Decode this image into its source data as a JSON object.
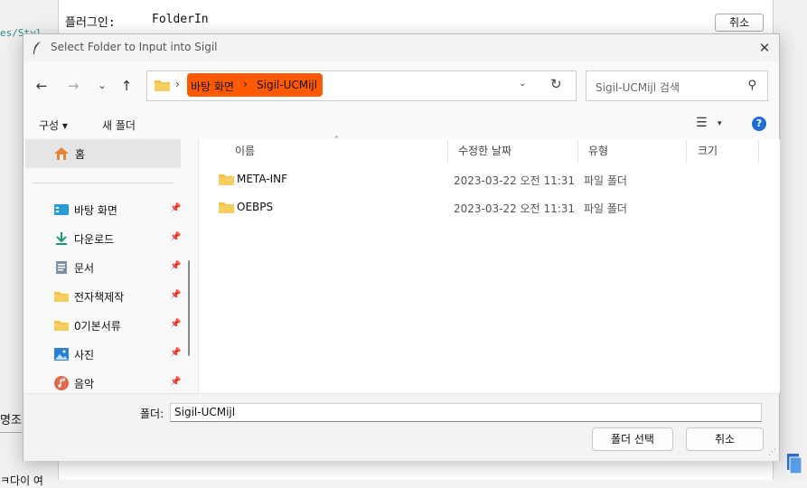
{
  "background": {
    "plugin_label": "플러그인:",
    "plugin_value": "FolderIn",
    "cancel_label": "취소",
    "code_snippet": "es/Styl",
    "left_text": "명조",
    "bottom_left_text": "ㅋ다이 여"
  },
  "dialog": {
    "title": "Select Folder to Input into Sigil",
    "close_glyph": "✕"
  },
  "navigation": {
    "back_glyph": "←",
    "forward_glyph": "→",
    "recent_glyph": "⌄",
    "up_glyph": "↑",
    "breadcrumb_sep": "›",
    "breadcrumbs": [
      "바탕 화면",
      "Sigil-UCMijl"
    ],
    "address_dropdown_glyph": "⌄",
    "refresh_glyph": "↻",
    "search_placeholder": "Sigil-UCMijl 검색",
    "search_glyph": "⚲"
  },
  "command_bar": {
    "organize": "구성 ▾",
    "new_folder": "새 폴더",
    "view_glyph": "☰",
    "view_dropdown_glyph": "▾",
    "help_glyph": "?"
  },
  "sidebar": {
    "home_label": "홈",
    "pin_glyph": "📌",
    "items": [
      {
        "label": "바탕 화면",
        "icon": "desktop-icon"
      },
      {
        "label": "다운로드",
        "icon": "download-icon"
      },
      {
        "label": "문서",
        "icon": "document-icon"
      },
      {
        "label": "전자책제작",
        "icon": "folder-icon"
      },
      {
        "label": "0기본서류",
        "icon": "folder-icon"
      },
      {
        "label": "사진",
        "icon": "pictures-icon"
      },
      {
        "label": "음악",
        "icon": "music-icon"
      }
    ]
  },
  "file_list": {
    "columns": {
      "name": "이름",
      "date": "수정한 날짜",
      "type": "유형",
      "size": "크기"
    },
    "sort_glyph": "˄",
    "rows": [
      {
        "name": "META-INF",
        "date": "2023-03-22 오전 11:31",
        "type": "파일 폴더"
      },
      {
        "name": "OEBPS",
        "date": "2023-03-22 오전 11:31",
        "type": "파일 폴더"
      }
    ]
  },
  "footer": {
    "folder_label": "폴더:",
    "folder_value": "Sigil-UCMijl",
    "select_button": "폴더 선택",
    "cancel_button": "취소",
    "grip_glyph": "⋰"
  },
  "colors": {
    "breadcrumb_highlight": "#ff5a00",
    "help_blue": "#1e6fd0",
    "folder_yellow": "#f4c245"
  }
}
